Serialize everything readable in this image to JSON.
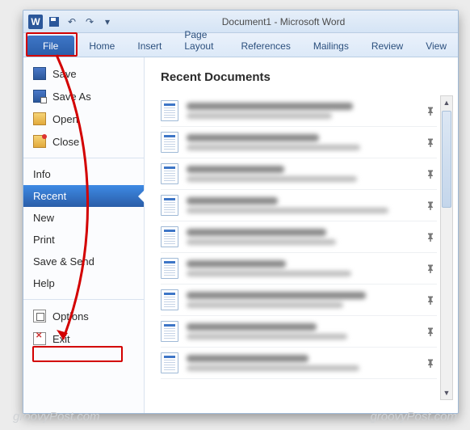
{
  "window": {
    "app_letter": "W",
    "title_doc": "Document1",
    "title_app": "Microsoft Word"
  },
  "qat": {
    "save": "save-icon",
    "undo": "undo-icon",
    "redo": "redo-icon",
    "customize": "customize-icon"
  },
  "ribbon": {
    "tabs": [
      {
        "id": "file",
        "label": "File"
      },
      {
        "id": "home",
        "label": "Home"
      },
      {
        "id": "insert",
        "label": "Insert"
      },
      {
        "id": "pagelayout",
        "label": "Page Layout"
      },
      {
        "id": "references",
        "label": "References"
      },
      {
        "id": "mailings",
        "label": "Mailings"
      },
      {
        "id": "review",
        "label": "Review"
      },
      {
        "id": "view",
        "label": "View"
      }
    ]
  },
  "backstage": {
    "items": [
      {
        "id": "save",
        "label": "Save",
        "icon": "save"
      },
      {
        "id": "saveas",
        "label": "Save As",
        "icon": "saveas"
      },
      {
        "id": "open",
        "label": "Open",
        "icon": "open"
      },
      {
        "id": "close",
        "label": "Close",
        "icon": "close"
      }
    ],
    "sections": [
      {
        "id": "info",
        "label": "Info"
      },
      {
        "id": "recent",
        "label": "Recent",
        "selected": true
      },
      {
        "id": "new",
        "label": "New"
      },
      {
        "id": "print",
        "label": "Print"
      },
      {
        "id": "savesend",
        "label": "Save & Send"
      },
      {
        "id": "help",
        "label": "Help"
      }
    ],
    "footer": [
      {
        "id": "options",
        "label": "Options",
        "icon": "options"
      },
      {
        "id": "exit",
        "label": "Exit",
        "icon": "exit"
      }
    ]
  },
  "main": {
    "heading": "Recent Documents",
    "document_count": 9
  },
  "watermark": "groovyPost.com",
  "annotations": {
    "highlight_file_tab": true,
    "highlight_options": true,
    "arrow_from": "file-tab",
    "arrow_to": "options-item",
    "color": "#d30000"
  }
}
